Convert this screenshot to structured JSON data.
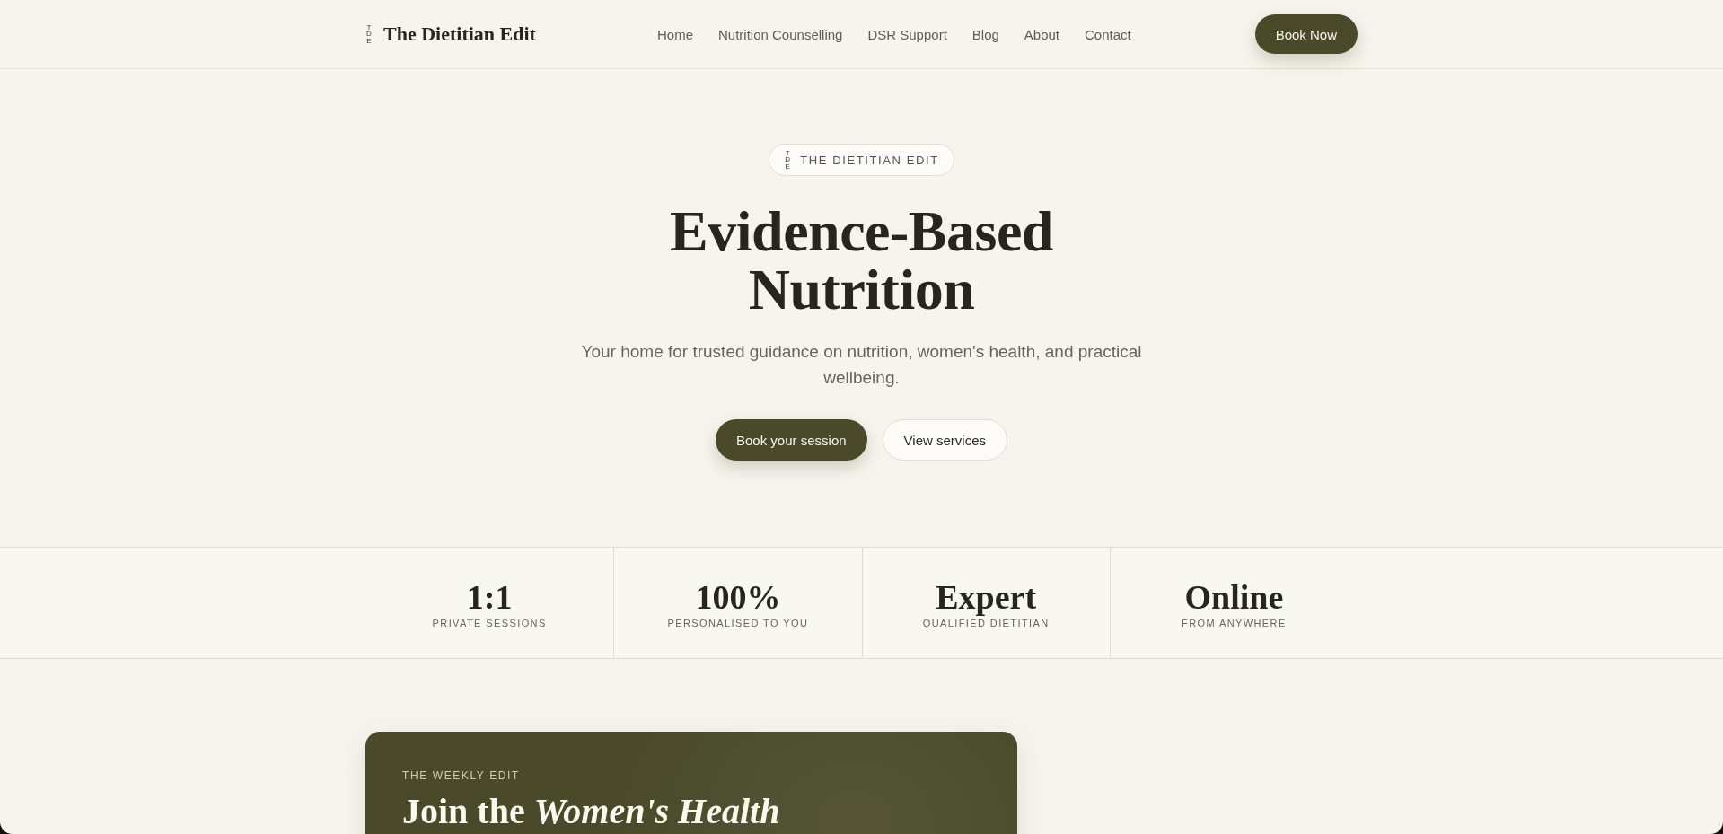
{
  "header": {
    "logo": {
      "mark": "TDE",
      "name": "The Dietitian Edit"
    },
    "nav": [
      "Home",
      "Nutrition Counselling",
      "DSR Support",
      "Blog",
      "About",
      "Contact"
    ],
    "cta": "Book Now"
  },
  "hero": {
    "badge": {
      "mark": "TDE",
      "label": "THE DIETITIAN EDIT"
    },
    "title": "Evidence-Based Nutrition",
    "subtitle": "Your home for trusted guidance on nutrition, women's health, and practical wellbeing.",
    "buttons": [
      {
        "label": "Book your session",
        "kind": "primary"
      },
      {
        "label": "View services",
        "kind": "secondary"
      }
    ]
  },
  "stats": [
    {
      "value": "1:1",
      "label": "PRIVATE SESSIONS"
    },
    {
      "value": "100%",
      "label": "PERSONALISED TO YOU"
    },
    {
      "value": "Expert",
      "label": "QUALIFIED DIETITIAN"
    },
    {
      "value": "Online",
      "label": "FROM ANYWHERE"
    }
  ],
  "newsletter": {
    "eyebrow": "THE WEEKLY EDIT",
    "title": "Join the *Women's Health*"
  }
}
